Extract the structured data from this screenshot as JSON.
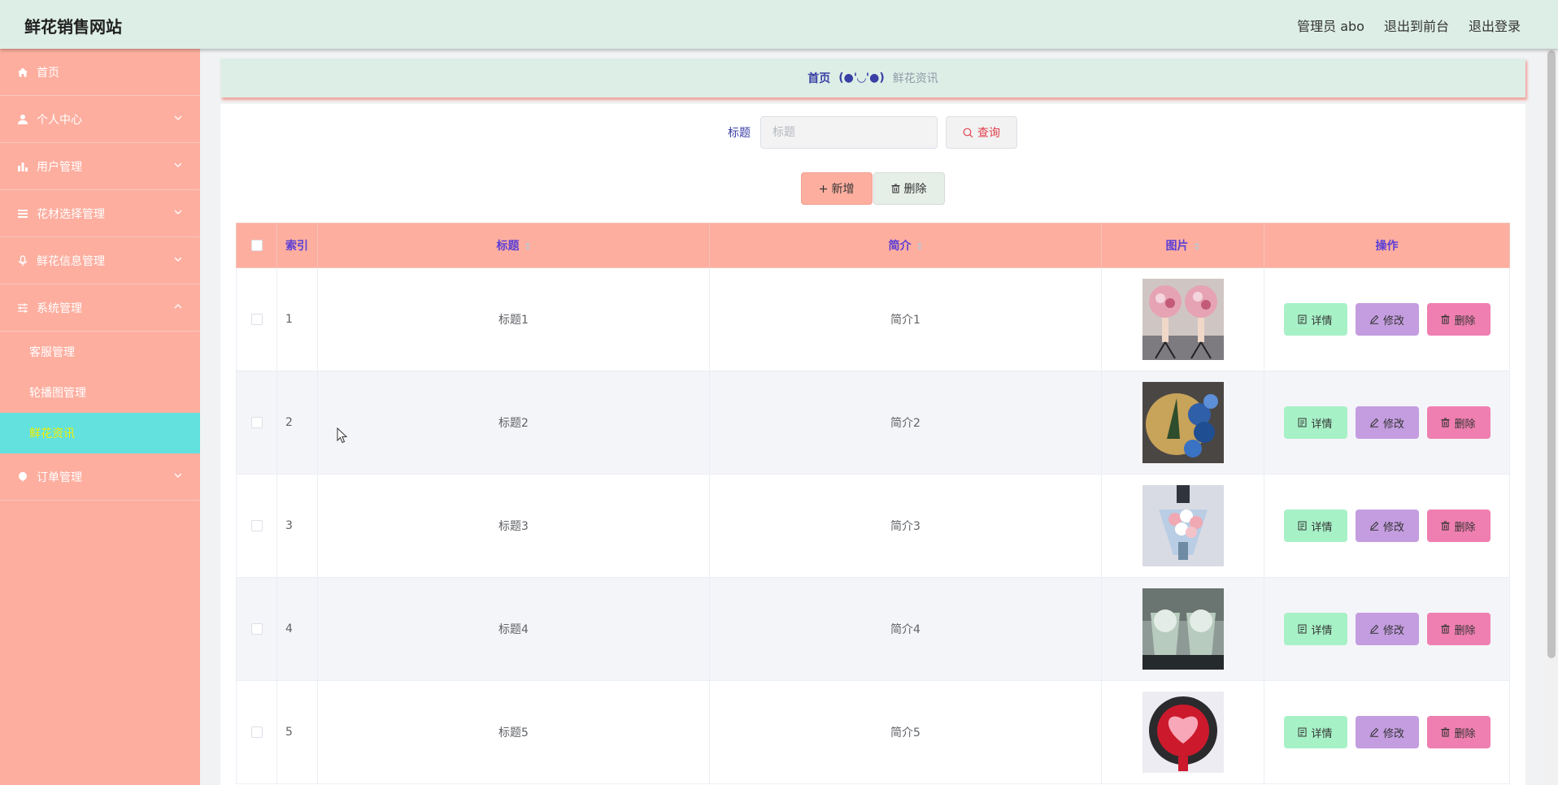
{
  "header": {
    "brand": "鲜花销售网站",
    "admin_label": "管理员 abo",
    "to_front_label": "退出到前台",
    "logout_label": "退出登录"
  },
  "sidebar": {
    "items": [
      {
        "label": "首页",
        "icon": "home-icon"
      },
      {
        "label": "个人中心",
        "icon": "user-icon"
      },
      {
        "label": "用户管理",
        "icon": "bar-chart-icon"
      },
      {
        "label": "花材选择管理",
        "icon": "list-icon"
      },
      {
        "label": "鲜花信息管理",
        "icon": "microphone-icon"
      },
      {
        "label": "系统管理",
        "icon": "sliders-icon"
      },
      {
        "label": "订单管理",
        "icon": "balloon-icon"
      }
    ],
    "system_sub": [
      "客服管理",
      "轮播图管理",
      "鲜花资讯"
    ],
    "active_sub": "鲜花资讯"
  },
  "breadcrumb": {
    "home": "首页",
    "separator": "(●'◡'●)",
    "current": "鲜花资讯"
  },
  "search": {
    "label": "标题",
    "placeholder": "标题",
    "query_button": "查询"
  },
  "actions": {
    "add": "新增",
    "delete": "删除"
  },
  "table": {
    "columns": [
      "索引",
      "标题",
      "简介",
      "图片",
      "操作"
    ],
    "rows": [
      {
        "index": "1",
        "title": "标题1",
        "intro": "简介1"
      },
      {
        "index": "2",
        "title": "标题2",
        "intro": "简介2"
      },
      {
        "index": "3",
        "title": "标题3",
        "intro": "简介3"
      },
      {
        "index": "4",
        "title": "标题4",
        "intro": "简介4"
      },
      {
        "index": "5",
        "title": "标题5",
        "intro": "简介5"
      }
    ],
    "row_actions": {
      "detail": "详情",
      "edit": "修改",
      "delete": "删除"
    }
  },
  "colors": {
    "sidebar_bg": "#fdae9f",
    "header_bg": "#ddeee6",
    "active_sub_bg": "#62e1de",
    "detail_btn": "#a7f1c7",
    "edit_btn": "#c49de0",
    "delete_btn": "#ef7fb0"
  }
}
